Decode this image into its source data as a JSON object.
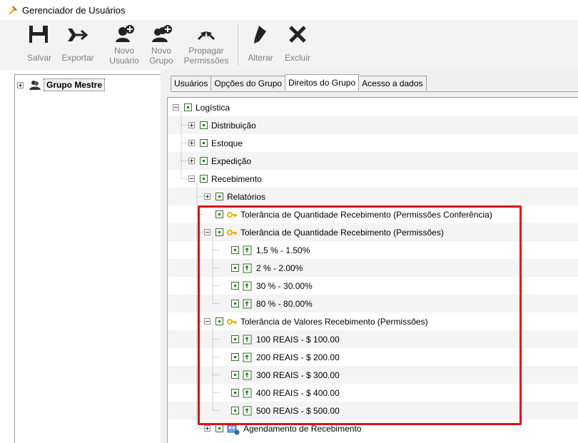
{
  "window": {
    "title": "Gerenciador de Usuários",
    "app_icon": "pick-icon"
  },
  "toolbar": {
    "buttons": [
      {
        "id": "salvar",
        "label": "Salvar",
        "icon": "floppy-disk-icon"
      },
      {
        "id": "exportar",
        "label": "Exportar",
        "icon": "export-arrow-icon"
      },
      {
        "id": "novo_usuario",
        "label_line1": "Novo",
        "label_line2": "Usuário",
        "icon": "add-user-icon"
      },
      {
        "id": "novo_grupo",
        "label_line1": "Novo",
        "label_line2": "Grupo",
        "icon": "add-group-icon"
      },
      {
        "id": "propagar",
        "label_line1": "Propagar",
        "label_line2": "Permissões",
        "icon": "propagate-icon"
      },
      {
        "id": "alterar",
        "label": "Alterar",
        "icon": "pencil-icon"
      },
      {
        "id": "excluir",
        "label": "Excluir",
        "icon": "x-icon"
      }
    ]
  },
  "group_tree": {
    "root_label": "Grupo Mestre",
    "root_icon": "group-icon"
  },
  "tabs": [
    {
      "label": "Usuários",
      "active": false
    },
    {
      "label": "Opções do Grupo",
      "active": false
    },
    {
      "label": "Direitos do Grupo",
      "active": true
    },
    {
      "label": "Acesso a dados",
      "active": false
    }
  ],
  "rights_tree": {
    "nodes": [
      {
        "label": "Logística",
        "level": 0,
        "expander": "minus",
        "icon": ""
      },
      {
        "label": "Distribuição",
        "level": 1,
        "expander": "plus",
        "icon": ""
      },
      {
        "label": "Estoque",
        "level": 1,
        "expander": "plus",
        "icon": ""
      },
      {
        "label": "Expedição",
        "level": 1,
        "expander": "plus",
        "icon": ""
      },
      {
        "label": "Recebimento",
        "level": 1,
        "expander": "minus",
        "icon": ""
      },
      {
        "label": "Relatórios",
        "level": 2,
        "expander": "plus",
        "icon": ""
      },
      {
        "label": "Tolerância de Quantidade Recebimento (Permissões Conferência)",
        "level": 2,
        "expander": "none",
        "icon": "key-icon"
      },
      {
        "label": "Tolerância de Quantidade Recebimento (Permissões)",
        "level": 2,
        "expander": "minus",
        "icon": "key-icon"
      },
      {
        "label": "1,5 % - 1.50%",
        "level": 3,
        "expander": "none",
        "icon": "item-icon"
      },
      {
        "label": "2 % - 2.00%",
        "level": 3,
        "expander": "none",
        "icon": "item-icon"
      },
      {
        "label": "30 % - 30.00%",
        "level": 3,
        "expander": "none",
        "icon": "item-icon"
      },
      {
        "label": "80 % - 80.00%",
        "level": 3,
        "expander": "none",
        "icon": "item-icon"
      },
      {
        "label": "Tolerância de Valores Recebimento (Permissões)",
        "level": 2,
        "expander": "minus",
        "icon": "key-icon"
      },
      {
        "label": "100 REAIS - $ 100.00",
        "level": 3,
        "expander": "none",
        "icon": "item-icon"
      },
      {
        "label": "200 REAIS - $ 200.00",
        "level": 3,
        "expander": "none",
        "icon": "item-icon"
      },
      {
        "label": "300 REAIS - $ 300.00",
        "level": 3,
        "expander": "none",
        "icon": "item-icon"
      },
      {
        "label": "400 REAIS - $ 400.00",
        "level": 3,
        "expander": "none",
        "icon": "item-icon"
      },
      {
        "label": "500 REAIS - $ 500.00",
        "level": 3,
        "expander": "none",
        "icon": "item-icon"
      },
      {
        "label": "Agendamento de Recebimento",
        "level": 2,
        "expander": "plus",
        "icon": "calendar-icon"
      }
    ]
  },
  "colors": {
    "highlight": "#e0101a",
    "check_green": "#1e7d22",
    "key_yellow": "#e8b400"
  }
}
